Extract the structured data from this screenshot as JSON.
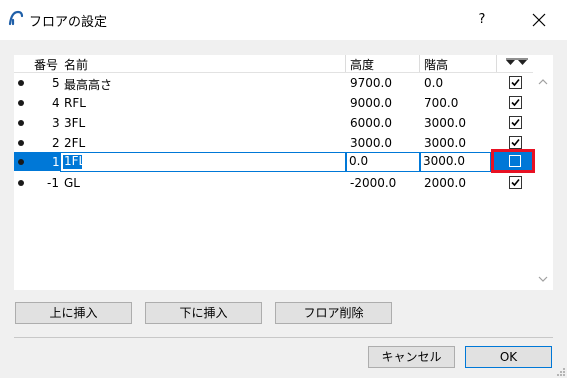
{
  "window": {
    "title": "フロアの設定",
    "help": "?"
  },
  "table": {
    "headers": {
      "number": "番号",
      "name": "名前",
      "height": "高度",
      "floor_height": "階高"
    },
    "rows": [
      {
        "number": "5",
        "name": "最高高さ",
        "height": "9700.0",
        "floor_height": "0.0",
        "checked": true
      },
      {
        "number": "4",
        "name": "RFL",
        "height": "9000.0",
        "floor_height": "700.0",
        "checked": true
      },
      {
        "number": "3",
        "name": "3FL",
        "height": "6000.0",
        "floor_height": "3000.0",
        "checked": true
      },
      {
        "number": "2",
        "name": "2FL",
        "height": "3000.0",
        "floor_height": "3000.0",
        "checked": true
      },
      {
        "number": "1",
        "name": "1FL",
        "height": "0.0",
        "floor_height": "3000.0",
        "checked": false
      },
      {
        "number": "-1",
        "name": "GL",
        "height": "-2000.0",
        "floor_height": "2000.0",
        "checked": true
      }
    ]
  },
  "buttons": {
    "insert_above": "上に挿入",
    "insert_below": "下に挿入",
    "delete_floor": "フロア削除",
    "cancel": "キャンセル",
    "ok": "OK"
  },
  "colors": {
    "selection": "#0078d7",
    "highlight_border": "#e81123"
  },
  "icons": [
    "app-icon",
    "close-icon",
    "sort-arrows-icon",
    "scroll-up-icon",
    "scroll-down-icon",
    "resize-grip-icon"
  ]
}
